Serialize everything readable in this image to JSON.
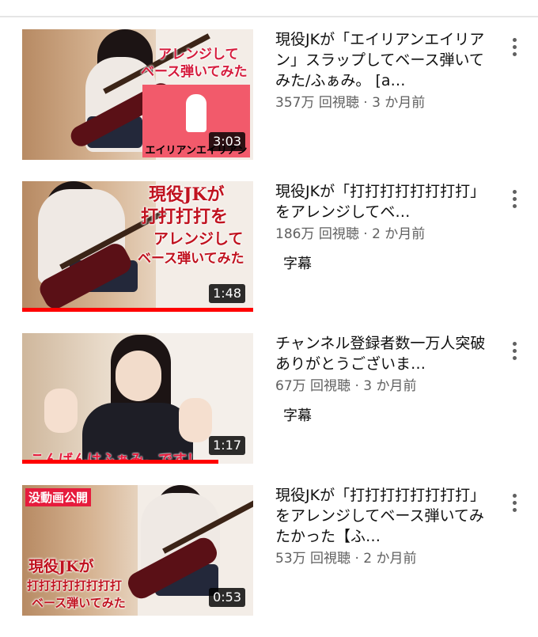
{
  "videos": [
    {
      "title": "現役JKが「エイリアンエイリアン」スラップしてベース弾いてみた/ふぁみ。 [a…",
      "views": "357万 回視聴",
      "age": "3 か月前",
      "duration": "3:03",
      "badge": "",
      "overlay_lines": [
        "アレンジして",
        "ベース弾いてみた"
      ],
      "panel_caption": "エイリアンエイリアン",
      "progress": 0
    },
    {
      "title": "現役JKが「打打打打打打打打」をアレンジしてベ…",
      "views": "186万 回視聴",
      "age": "2 か月前",
      "duration": "1:48",
      "badge": "字幕",
      "overlay_lines": [
        "現役JKが",
        "打打打打を",
        "アレンジして",
        "ベース弾いてみた"
      ],
      "progress": 1.0
    },
    {
      "title": "チャンネル登録者数一万人突破ありがとうございま…",
      "views": "67万 回視聴",
      "age": "3 か月前",
      "duration": "1:17",
      "badge": "字幕",
      "overlay_lines": [
        "こんばんはふぁみ。です！"
      ],
      "progress": 0.85
    },
    {
      "title": "現役JKが「打打打打打打打打」をアレンジしてベース弾いてみたかった【ふ…",
      "views": "53万 回視聴",
      "age": "2 か月前",
      "duration": "0:53",
      "badge": "",
      "overlay_lines": [
        "没動画公開",
        "現役JKが",
        "打打打打打打打打",
        "ベース弾いてみた"
      ],
      "progress": 0
    }
  ],
  "separator": " · ",
  "icons": {
    "menu": "more-vert-icon"
  },
  "colors": {
    "progress": "#ff0000",
    "overlay_red": "#c0121f",
    "meta_gray": "#606060"
  }
}
